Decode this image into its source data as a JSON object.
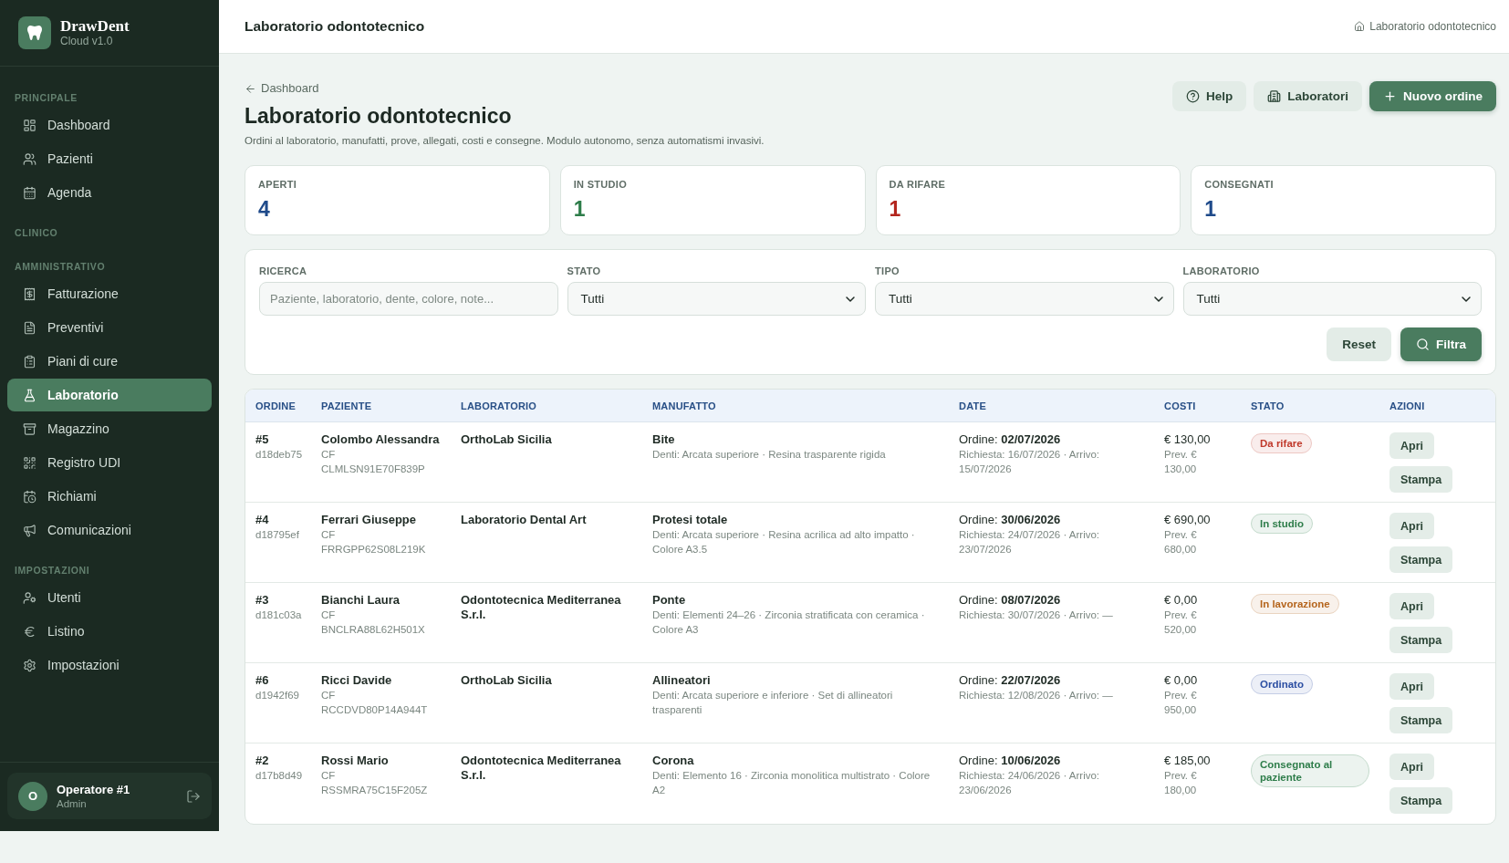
{
  "sidebar": {
    "brand": {
      "name": "DrawDent",
      "version": "Cloud v1.0"
    },
    "sections": [
      {
        "title": "PRINCIPALE",
        "items": [
          {
            "label": "Dashboard",
            "selected": false
          },
          {
            "label": "Pazienti",
            "selected": false
          },
          {
            "label": "Agenda",
            "selected": false
          }
        ]
      },
      {
        "title": "CLINICO"
      },
      {
        "title": "AMMINISTRATIVO",
        "items": [
          {
            "label": "Fatturazione",
            "selected": false
          },
          {
            "label": "Preventivi",
            "selected": false
          },
          {
            "label": "Piani di cure",
            "selected": false
          },
          {
            "label": "Laboratorio",
            "selected": true
          },
          {
            "label": "Magazzino",
            "selected": false
          },
          {
            "label": "Registro UDI",
            "selected": false
          },
          {
            "label": "Richiami",
            "selected": false
          },
          {
            "label": "Comunicazioni",
            "selected": false
          }
        ]
      },
      {
        "title": "IMPOSTAZIONI",
        "items": [
          {
            "label": "Utenti",
            "selected": false
          },
          {
            "label": "Listino",
            "selected": false
          },
          {
            "label": "Impostazioni",
            "selected": false
          }
        ]
      }
    ],
    "user": {
      "initial": "O",
      "name": "Operatore #1",
      "role": "Admin"
    }
  },
  "topbar": {
    "title": "Laboratorio odontotecnico",
    "breadcrumb": "Laboratorio odontotecnico"
  },
  "page_header": {
    "back_link": "Dashboard",
    "title": "Laboratorio odontotecnico",
    "subtitle": "Ordini al laboratorio, manufatti, prove, allegati, costi e consegne. Modulo autonomo, senza automatismi invasivi.",
    "actions": [
      {
        "label": "Help",
        "kind": "secondary"
      },
      {
        "label": "Laboratori",
        "kind": "secondary"
      },
      {
        "label": "Nuovo ordine",
        "kind": "primary"
      }
    ]
  },
  "stats": [
    {
      "label": "APERTI",
      "value": "4",
      "color": "#1f4a8a"
    },
    {
      "label": "IN STUDIO",
      "value": "1",
      "color": "#2e7d4a"
    },
    {
      "label": "DA RIFARE",
      "value": "1",
      "color": "#b3261e"
    },
    {
      "label": "CONSEGNATI",
      "value": "1",
      "color": "#1f4a8a"
    }
  ],
  "filters": {
    "search": {
      "label": "RICERCA",
      "placeholder": "Paziente, laboratorio, dente, colore, note..."
    },
    "selects": [
      {
        "label": "STATO",
        "value": "Tutti"
      },
      {
        "label": "TIPO",
        "value": "Tutti"
      },
      {
        "label": "LABORATORIO",
        "value": "Tutti"
      }
    ],
    "buttons": [
      {
        "label": "Reset",
        "kind": "secondary"
      },
      {
        "label": "Filtra",
        "kind": "primary"
      }
    ]
  },
  "table": {
    "columns": [
      "ORDINE",
      "PAZIENTE",
      "LABORATORIO",
      "MANUFATTO",
      "DATE",
      "COSTI",
      "STATO",
      "AZIONI"
    ],
    "rows": [
      {
        "order": "#5",
        "code": "d18deb75",
        "patient": "Colombo Alessandra",
        "tax_code": "CF CLMLSN91E70F839P",
        "lab": "OrthoLab Sicilia",
        "item": "Bite",
        "details": "Denti: Arcata superiore · Resina trasparente rigida",
        "order_date": "Ordine: **02/07/2026**",
        "dates": "Richiesta: 16/07/2026 · Arrivo: 15/07/2026",
        "cost": "€ 130,00",
        "estimate": "Prev. € 130,00",
        "status": {
          "label": "Da rifare",
          "color": "#c0392b"
        },
        "actions": [
          "Apri",
          "Stampa"
        ]
      },
      {
        "order": "#4",
        "code": "d18795ef",
        "patient": "Ferrari Giuseppe",
        "tax_code": "CF FRRGPP62S08L219K",
        "lab": "Laboratorio Dental Art",
        "item": "Protesi totale",
        "details": "Denti: Arcata superiore · Resina acrilica ad alto impatto · Colore A3.5",
        "order_date": "Ordine: **30/06/2026**",
        "dates": "Richiesta: 24/07/2026 · Arrivo: 23/07/2026",
        "cost": "€ 690,00",
        "estimate": "Prev. € 680,00",
        "status": {
          "label": "In studio",
          "color": "#2e7d4a"
        },
        "actions": [
          "Apri",
          "Stampa"
        ]
      },
      {
        "order": "#3",
        "code": "d181c03a",
        "patient": "Bianchi Laura",
        "tax_code": "CF BNCLRA88L62H501X",
        "lab": "Odontotecnica Mediterranea S.r.l.",
        "item": "Ponte",
        "details": "Denti: Elementi 24–26 · Zirconia stratificata con ceramica · Colore A3",
        "order_date": "Ordine: **08/07/2026**",
        "dates": "Richiesta: 30/07/2026 · Arrivo: —",
        "cost": "€ 0,00",
        "estimate": "Prev. € 520,00",
        "status": {
          "label": "In lavorazione",
          "color": "#b5651d"
        },
        "actions": [
          "Apri",
          "Stampa"
        ]
      },
      {
        "order": "#6",
        "code": "d1942f69",
        "patient": "Ricci Davide",
        "tax_code": "CF RCCDVD80P14A944T",
        "lab": "OrthoLab Sicilia",
        "item": "Allineatori",
        "details": "Denti: Arcata superiore e inferiore · Set di allineatori trasparenti",
        "order_date": "Ordine: **22/07/2026**",
        "dates": "Richiesta: 12/08/2026 · Arrivo: —",
        "cost": "€ 0,00",
        "estimate": "Prev. € 950,00",
        "status": {
          "label": "Ordinato",
          "color": "#2b4ea2"
        },
        "actions": [
          "Apri",
          "Stampa"
        ]
      },
      {
        "order": "#2",
        "code": "d17b8d49",
        "patient": "Rossi Mario",
        "tax_code": "CF RSSMRA75C15F205Z",
        "lab": "Odontotecnica Mediterranea S.r.l.",
        "item": "Corona",
        "details": "Denti: Elemento 16 · Zirconia monolitica multistrato · Colore A2",
        "order_date": "Ordine: **10/06/2026**",
        "dates": "Richiesta: 24/06/2026 · Arrivo: 23/06/2026",
        "cost": "€ 185,00",
        "estimate": "Prev. € 180,00",
        "status": {
          "label": "Consegnato al paziente",
          "color": "#2e7d4a"
        },
        "actions": [
          "Apri",
          "Stampa"
        ]
      }
    ]
  }
}
